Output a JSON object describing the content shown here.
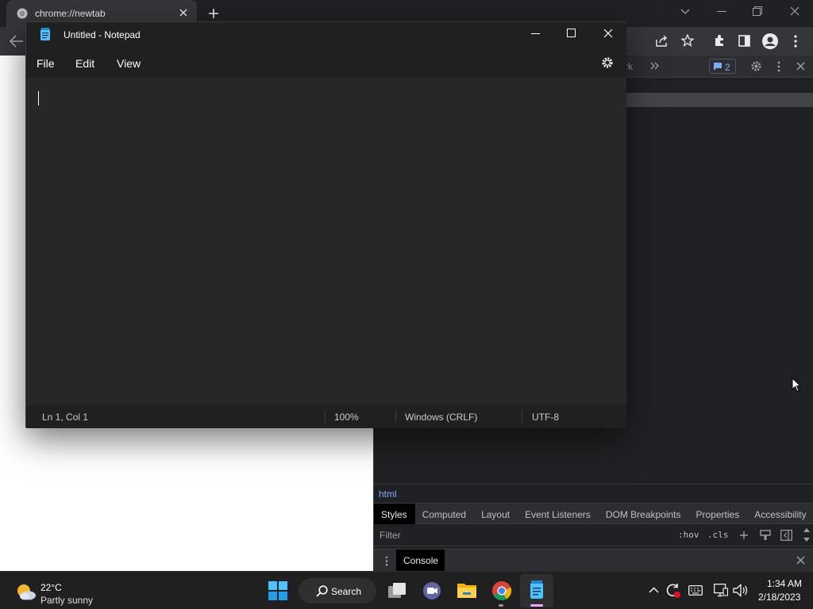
{
  "chrome": {
    "tab_title": "chrome://newtab"
  },
  "devtools": {
    "partial_tab_text": "rk",
    "issues_count": "2",
    "breadcrumb": "html",
    "subtabs": [
      "Styles",
      "Computed",
      "Layout",
      "Event Listeners",
      "DOM Breakpoints",
      "Properties",
      "Accessibility"
    ],
    "filter_placeholder": "Filter",
    "hov_label": ":hov",
    "cls_label": ".cls",
    "drawer_tab": "Console"
  },
  "notepad": {
    "title": "Untitled - Notepad",
    "menu": [
      "File",
      "Edit",
      "View"
    ],
    "status": {
      "position": "Ln 1, Col 1",
      "zoom": "100%",
      "line_ending": "Windows (CRLF)",
      "encoding": "UTF-8"
    }
  },
  "taskbar": {
    "weather_temp": "22°C",
    "weather_desc": "Partly sunny",
    "search_label": "Search",
    "time": "1:34 AM",
    "date": "2/18/2023"
  },
  "icons": {
    "start": "windows-start-icon",
    "search": "search-icon",
    "task_view": "task-view-icon",
    "teams": "teams-chat-icon",
    "explorer": "file-explorer-icon",
    "chrome": "chrome-icon",
    "notepad": "notepad-icon"
  },
  "colors": {
    "accent_blue": "#7cacf8",
    "taskbar": "#202020",
    "notepad_bg": "#272727"
  }
}
